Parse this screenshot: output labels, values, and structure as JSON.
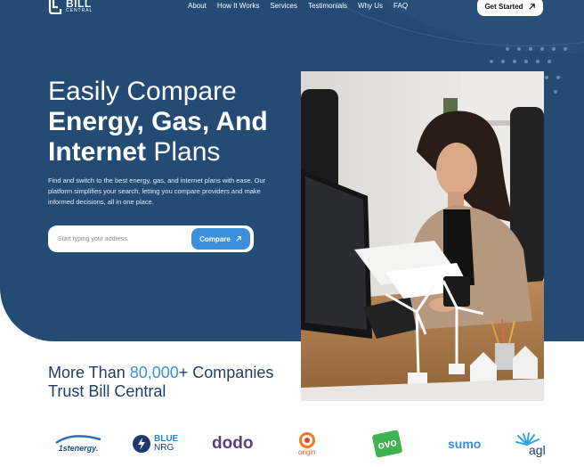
{
  "brand": {
    "name_line1": "BILL",
    "name_line2": "CENTRAL"
  },
  "nav": {
    "items": [
      "About",
      "How It Works",
      "Services",
      "Testimonials",
      "Why Us",
      "FAQ"
    ]
  },
  "header": {
    "cta_label": "Get Started"
  },
  "hero": {
    "headline_line1": "Easily Compare",
    "headline_line2": "Energy, Gas, And",
    "headline_line3_bold": "Internet",
    "headline_line3_rest": " Plans",
    "description": "Find and switch to the best energy, gas, and internet plans with ease. Our platform simplifies your search, letting you compare providers and make informed decisions, all in one place.",
    "search_placeholder": "Start typing your address",
    "compare_label": "Compare"
  },
  "trust": {
    "prefix": "More Than ",
    "number": "80,000",
    "suffix": "+ Companies",
    "line2": "Trust Bill Central"
  },
  "partners": {
    "p1": "1stenergy.",
    "p2_top": "BLUE",
    "p2_bottom": "NRG",
    "p3": "dodo",
    "p4": "origin",
    "p5": "ovo",
    "p6": "sumo",
    "p7": "agl"
  },
  "colors": {
    "hero_bg": "#234b74",
    "accent": "#3c8fdc",
    "heading_dark": "#1d3f67"
  }
}
